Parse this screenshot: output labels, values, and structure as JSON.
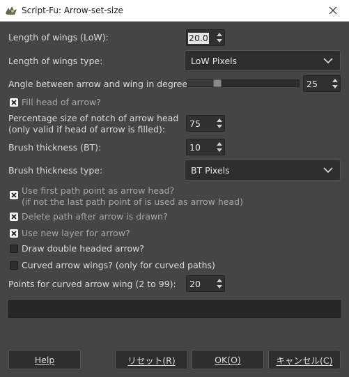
{
  "window": {
    "title": "Script-Fu: Arrow-set-size",
    "app_icon": "wilber-icon",
    "close_icon": "close-icon"
  },
  "fields": {
    "low_label": "Length of wings (LoW):",
    "low_value": "20.0",
    "low_type_label": "Length of wings type:",
    "low_type_value": "LoW Pixels",
    "angle_label": "Angle between arrow and wing in degrees:",
    "angle_value": "25",
    "angle_fraction": 0.25,
    "fill_head_label": "Fill head of arrow?",
    "fill_head_checked": true,
    "notch_label_line1": "Percentage size of notch of arrow head",
    "notch_label_line2": "(only valid if head of arrow is filled):",
    "notch_value": "75",
    "bt_label": "Brush thickness (BT):",
    "bt_value": "10",
    "bt_type_label": "Brush thickness type:",
    "bt_type_value": "BT Pixels",
    "first_point_line1": "Use first path point as arrow head?",
    "first_point_line2": "(if not the last path point of is used as arrow head)",
    "first_point_checked": true,
    "delete_path_label": "Delete path after arrow is drawn?",
    "delete_path_checked": true,
    "new_layer_label": "Use new layer for arrow?",
    "new_layer_checked": true,
    "double_headed_label": "Draw double headed arrow?",
    "double_headed_checked": false,
    "curved_wings_label": "Curved arrow wings? (only for curved paths)",
    "curved_wings_checked": false,
    "curve_points_label": "Points for curved arrow wing (2 to 99):",
    "curve_points_value": "20"
  },
  "buttons": {
    "help": "Help",
    "reset": "リセット(R)",
    "ok": "OK(O)",
    "cancel": "キャンセル(C)"
  }
}
